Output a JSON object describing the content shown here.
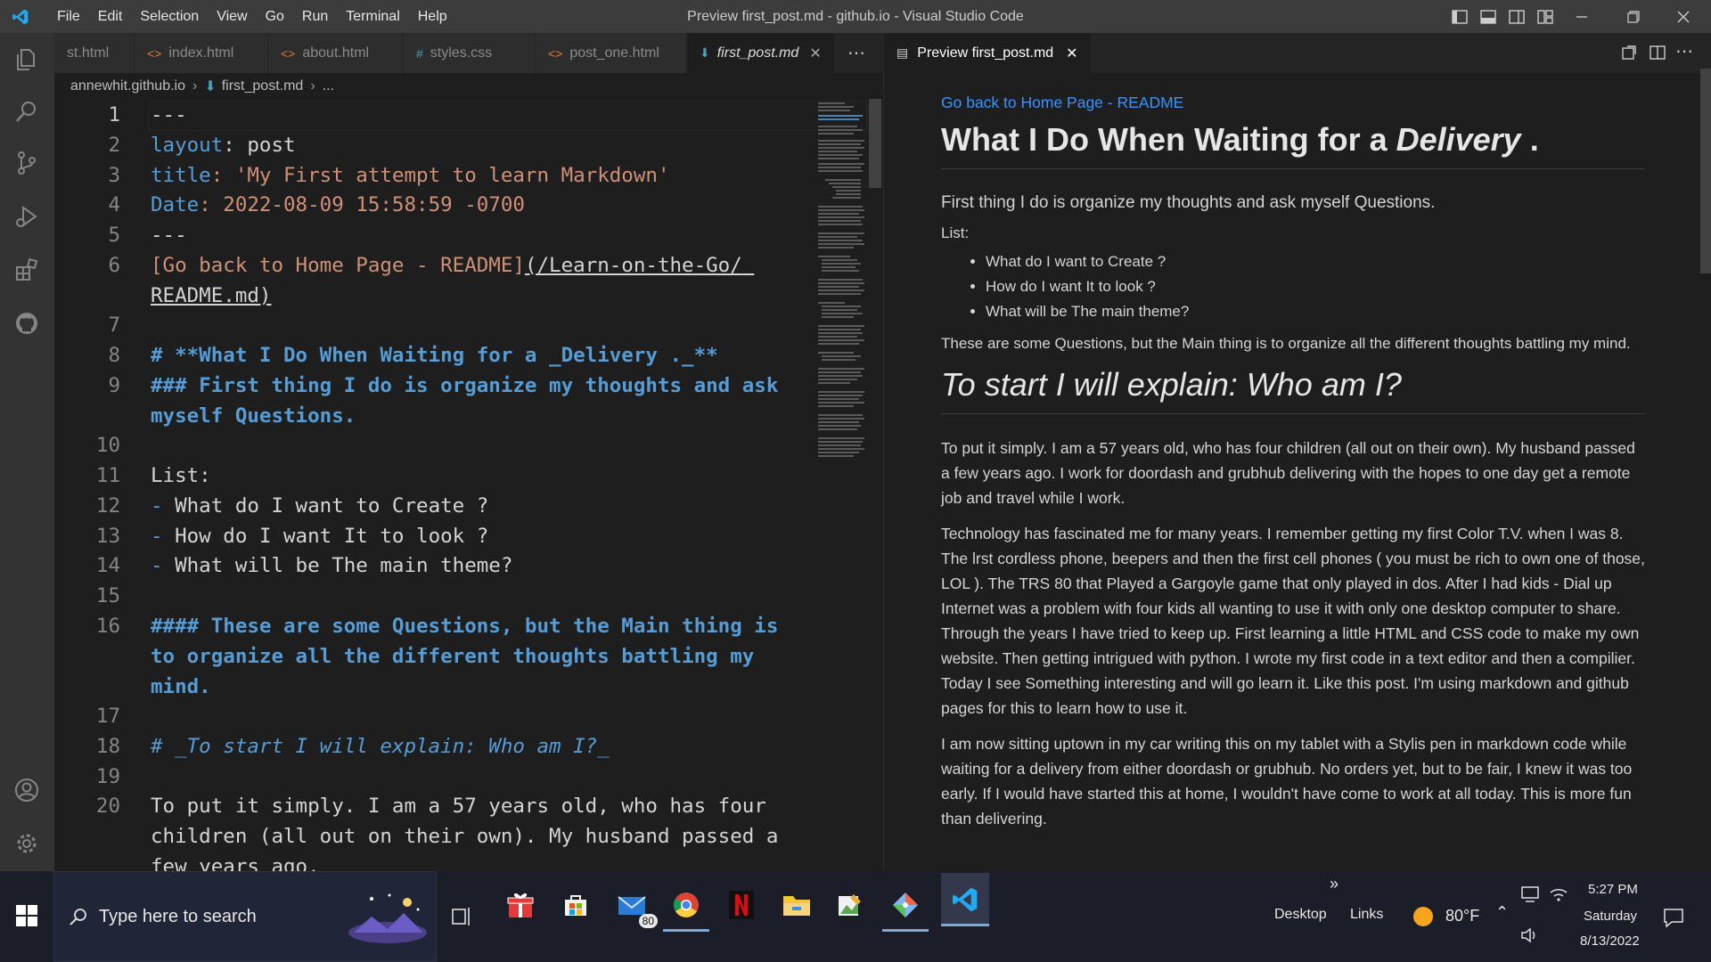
{
  "window": {
    "title": "Preview first_post.md - github.io - Visual Studio Code",
    "menu": [
      "File",
      "Edit",
      "Selection",
      "View",
      "Go",
      "Run",
      "Terminal",
      "Help"
    ]
  },
  "editor": {
    "tabs": [
      {
        "label": "st.html",
        "icon": "html-icon"
      },
      {
        "label": "index.html",
        "icon": "html-icon"
      },
      {
        "label": "about.html",
        "icon": "html-icon"
      },
      {
        "label": "styles.css",
        "icon": "css-icon"
      },
      {
        "label": "post_one.html",
        "icon": "html-icon"
      },
      {
        "label": "first_post.md",
        "icon": "markdown-icon",
        "active": true
      }
    ],
    "breadcrumb": [
      "annewhit.github.io",
      "first_post.md",
      "..."
    ],
    "line_numbers": [
      "1",
      "2",
      "3",
      "4",
      "5",
      "6",
      "7",
      "8",
      "9",
      "10",
      "11",
      "12",
      "13",
      "14",
      "15",
      "16",
      "17",
      "18",
      "19",
      "20"
    ],
    "lines": {
      "l1": "---",
      "l2_key": "layout",
      "l2_val": ": post",
      "l3_key": "title",
      "l3_val": ": 'My First attempt to learn Markdown'",
      "l4_key": "Date",
      "l4_val": ": 2022-08-09 15:58:59 -0700",
      "l5": "---",
      "l6_text": "[Go back to Home Page - README]",
      "l6_url": "(/Learn-on-the-Go/ README.md)",
      "l8": "# **What I Do When Waiting for a _Delivery ._**",
      "l9": "### First thing I do is organize my thoughts and ask myself Questions.",
      "l11": "List:",
      "l12": "What do I want to Create ?",
      "l13": "How do I want It to look ?",
      "l14": "What will be The main theme?",
      "l16": "#### These are some Questions, but the Main thing is to organize all the different thoughts battling my mind.",
      "l18": "# _To start I will explain: Who am I?_",
      "l20": "To put it simply. I am a 57 years old, who has four children (all out on their own). My husband passed a few years ago."
    }
  },
  "preview": {
    "tab_label": "Preview first_post.md",
    "link": "Go back to Home Page - README",
    "h1_prefix": "What I Do When Waiting for a ",
    "h1_italic": "Delivery",
    "h1_suffix": " .",
    "h3": "First thing I do is organize my thoughts and ask myself Questions.",
    "list_label": "List:",
    "list": [
      "What do I want to Create ?",
      "How do I want It to look ?",
      "What will be The main theme?"
    ],
    "h4": "These are some Questions, but the Main thing is to organize all the different thoughts battling my mind.",
    "h1b": "To start I will explain: Who am I?",
    "p1": "To put it simply. I am a 57 years old, who has four children (all out on their own). My husband passed a few years ago. I work for doordash and grubhub delivering with the hopes to one day get a remote job and travel while I work.",
    "p2": "Technology has fascinated me for many years. I remember getting my first Color T.V. when I was 8. The lrst cordless phone, beepers and then the first cell phones ( you must be rich to own one of those, LOL ). The TRS 80 that Played a Gargoyle game that only played in dos. After I had kids - Dial up Internet was a problem with four kids all wanting to use it with only one desktop computer to share. Through the years I have tried to keep up. First learning a little HTML and CSS code to make my own website. Then getting intrigued with python. I wrote my first code in a text editor and then a compilier. Today I see Something interesting and will go learn it. Like this post. I'm using markdown and github pages for this to learn how to use it.",
    "p3": "I am now sitting uptown in my car writing this on my tablet with a Stylis pen in markdown code while waiting for a delivery from either doordash or grubhub. No orders yet, but to be fair, I knew it was too early. If I would have started this at home, I wouldn't have come to work at all today. This is more fun than delivering."
  },
  "taskbar": {
    "search_placeholder": "Type here to search",
    "mail_badge": "80",
    "desktop_label": "Desktop",
    "links_label": "Links",
    "chevron": "»",
    "temperature": "80°F",
    "time": "5:27 PM",
    "day": "Saturday",
    "date": "8/13/2022"
  },
  "colors": {
    "accent": "#007acc",
    "link": "#3794ff",
    "keyword": "#569cd6",
    "string": "#ce9178"
  }
}
